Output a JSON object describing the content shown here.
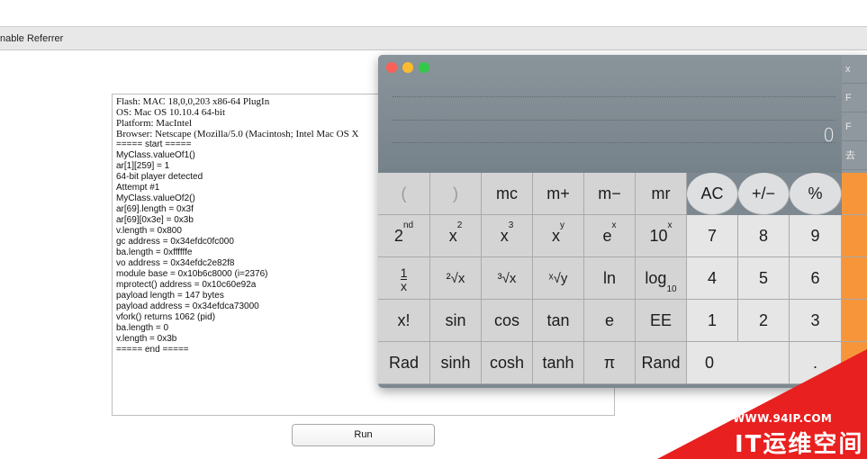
{
  "toolbar": {
    "title": "nable Referrer"
  },
  "log": {
    "lines": [
      "Flash: MAC 18,0,0,203 x86-64 PlugIn",
      "OS: Mac OS 10.10.4 64-bit",
      "Platform: MacIntel",
      "Browser: Netscape (Mozilla/5.0 (Macintosh; Intel Mac OS X",
      "===== start =====",
      "MyClass.valueOf1()",
      "ar[1][259] = 1",
      "64-bit player detected",
      "Attempt #1",
      "MyClass.valueOf2()",
      "ar[69].length = 0x3f",
      "ar[69][0x3e] = 0x3b",
      "v.length = 0x800",
      "gc address = 0x34efdc0fc000",
      "ba.length = 0xffffffe",
      "vo address = 0x34efdc2e82f8",
      "module base = 0x10b6c8000 (i=2376)",
      "mprotect() address = 0x10c60e92a",
      "payload length = 147 bytes",
      "payload address = 0x34efdca73000",
      "vfork() returns 1062 (pid)",
      "ba.length = 0",
      "v.length = 0x3b",
      "===== end ====="
    ]
  },
  "run_button": {
    "label": "Run"
  },
  "calculator": {
    "display_value": "0",
    "side_labels": [
      "x",
      "F",
      "F",
      "去"
    ],
    "colors": {
      "close": "#fc5f57",
      "minimize": "#fdbc2e",
      "zoom": "#34c84a",
      "operator": "#f7953b"
    },
    "keys": {
      "open_paren": "(",
      "close_paren": ")",
      "mc": "mc",
      "m_plus": "m+",
      "m_minus": "m−",
      "mr": "mr",
      "ac": "AC",
      "plus_minus": "+/−",
      "percent": "%",
      "second": "2",
      "second_sup": "nd",
      "x_squared": "x",
      "x_squared_sup": "2",
      "x_cubed": "x",
      "x_cubed_sup": "3",
      "x_pow_y": "x",
      "x_pow_y_sup": "y",
      "e_pow_x": "e",
      "e_pow_x_sup": "x",
      "ten_pow_x": "10",
      "ten_pow_x_sup": "x",
      "seven": "7",
      "eight": "8",
      "nine": "9",
      "one_over_x_num": "1",
      "one_over_x_den": "x",
      "sqrt2": "²√x",
      "sqrt3": "³√x",
      "sqrty": "ˣ√y",
      "ln": "ln",
      "log10": "log",
      "log10_sub": "10",
      "four": "4",
      "five": "5",
      "six": "6",
      "factorial": "x!",
      "sin": "sin",
      "cos": "cos",
      "tan": "tan",
      "e": "e",
      "ee": "EE",
      "one": "1",
      "two": "2",
      "three": "3",
      "rad": "Rad",
      "sinh": "sinh",
      "cosh": "cosh",
      "tanh": "tanh",
      "pi": "π",
      "rand": "Rand",
      "zero": "0",
      "decimal": "."
    }
  },
  "watermark": {
    "url": "WWW.94IP.COM",
    "brand": "IT运维空间"
  }
}
